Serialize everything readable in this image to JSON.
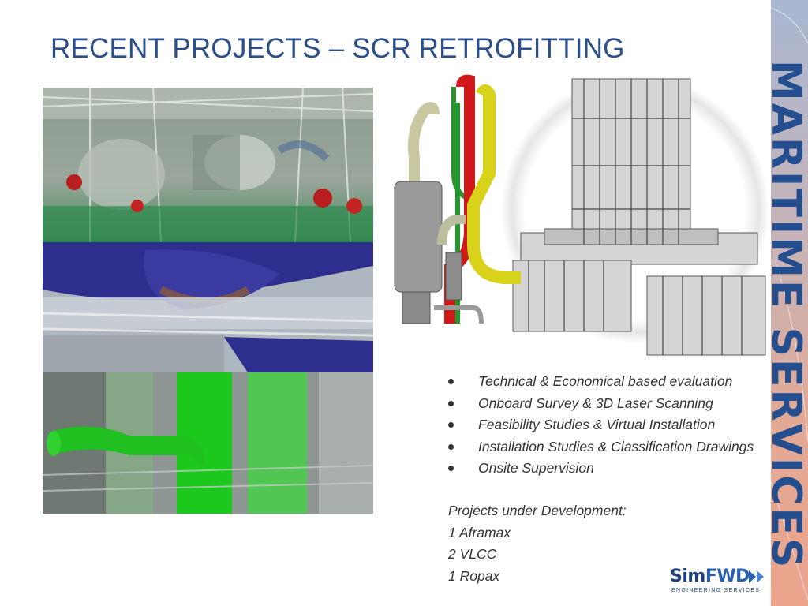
{
  "slide": {
    "title": "RECENT PROJECTS – SCR RETROFITTING",
    "side_banner": "MARITIME SERVICES",
    "bullets": [
      "Technical & Economical based evaluation",
      "Onboard Survey & 3D Laser Scanning",
      "Feasibility Studies & Virtual Installation",
      "Installation Studies & Classification Drawings",
      "Onsite Supervision"
    ],
    "projects": {
      "heading": "Projects under Development:",
      "items": [
        "1 Aframax",
        "2 VLCC",
        "1 Ropax"
      ]
    },
    "logo": {
      "name_part1": "Sim",
      "name_part2": "FWD",
      "tagline": "ENGINEERING SERVICES"
    }
  },
  "colors": {
    "title": "#2a4f8a",
    "banner_text": "#244e8e",
    "body_text": "#333333",
    "pipe_red": "#d0191b",
    "pipe_yellow": "#d9d21a",
    "pipe_green": "#1f9a2a",
    "laser_green": "#20c020"
  }
}
